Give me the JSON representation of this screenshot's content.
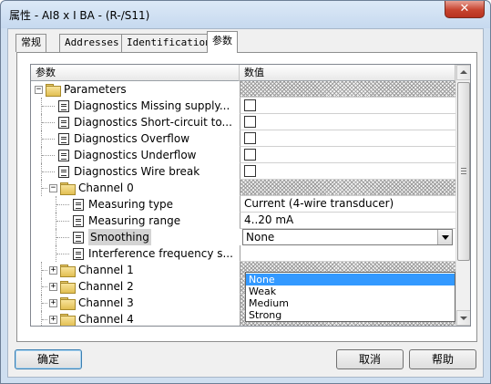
{
  "window": {
    "title": "属性 - AI8 x I BA - (R-/S11)",
    "close_glyph": "✕"
  },
  "tabs": [
    {
      "label": "常规",
      "active": false
    },
    {
      "label": "Addresses",
      "active": false
    },
    {
      "label": "Identification",
      "active": false
    },
    {
      "label": "参数",
      "active": true
    }
  ],
  "grid": {
    "headers": {
      "name": "参数",
      "value": "数值"
    },
    "rows": [
      {
        "label": "Parameters",
        "kind": "folder",
        "expander": "−",
        "value": "",
        "value_type": "hatch"
      },
      {
        "label": "Diagnostics Missing supply...",
        "kind": "param",
        "value": "",
        "value_type": "checkbox",
        "checked": false
      },
      {
        "label": "Diagnostics Short-circuit to...",
        "kind": "param",
        "value": "",
        "value_type": "checkbox",
        "checked": false
      },
      {
        "label": "Diagnostics Overflow",
        "kind": "param",
        "value": "",
        "value_type": "checkbox",
        "checked": false
      },
      {
        "label": "Diagnostics Underflow",
        "kind": "param",
        "value": "",
        "value_type": "checkbox",
        "checked": false
      },
      {
        "label": "Diagnostics Wire break",
        "kind": "param",
        "value": "",
        "value_type": "checkbox",
        "checked": false
      },
      {
        "label": "Channel 0",
        "kind": "folder",
        "expander": "−",
        "value": "",
        "value_type": "hatch"
      },
      {
        "label": "Measuring type",
        "kind": "param",
        "value": "Current (4-wire transducer)",
        "value_type": "text"
      },
      {
        "label": "Measuring range",
        "kind": "param",
        "value": "4..20 mA",
        "value_type": "text"
      },
      {
        "label": "Smoothing",
        "kind": "param",
        "value": "None",
        "value_type": "dropdown",
        "selected": true
      },
      {
        "label": "Interference frequency s...",
        "kind": "param",
        "value": "",
        "value_type": "text"
      },
      {
        "label": "Channel 1",
        "kind": "folder",
        "expander": "+",
        "value": "",
        "value_type": "hatch"
      },
      {
        "label": "Channel 2",
        "kind": "folder",
        "expander": "+",
        "value": "",
        "value_type": "hatch"
      },
      {
        "label": "Channel 3",
        "kind": "folder",
        "expander": "+",
        "value": "",
        "value_type": "hatch"
      },
      {
        "label": "Channel 4",
        "kind": "folder",
        "expander": "+",
        "value": "",
        "value_type": "hatch"
      }
    ]
  },
  "dropdown_options": [
    "None",
    "Weak",
    "Medium",
    "Strong"
  ],
  "dropdown_selected": "None",
  "buttons": {
    "ok": "确定",
    "cancel": "取消",
    "help": "帮助"
  },
  "colors": {
    "selection": "#3399ff",
    "window_frame": "#cfdff0",
    "close_button": "#c7432f"
  }
}
